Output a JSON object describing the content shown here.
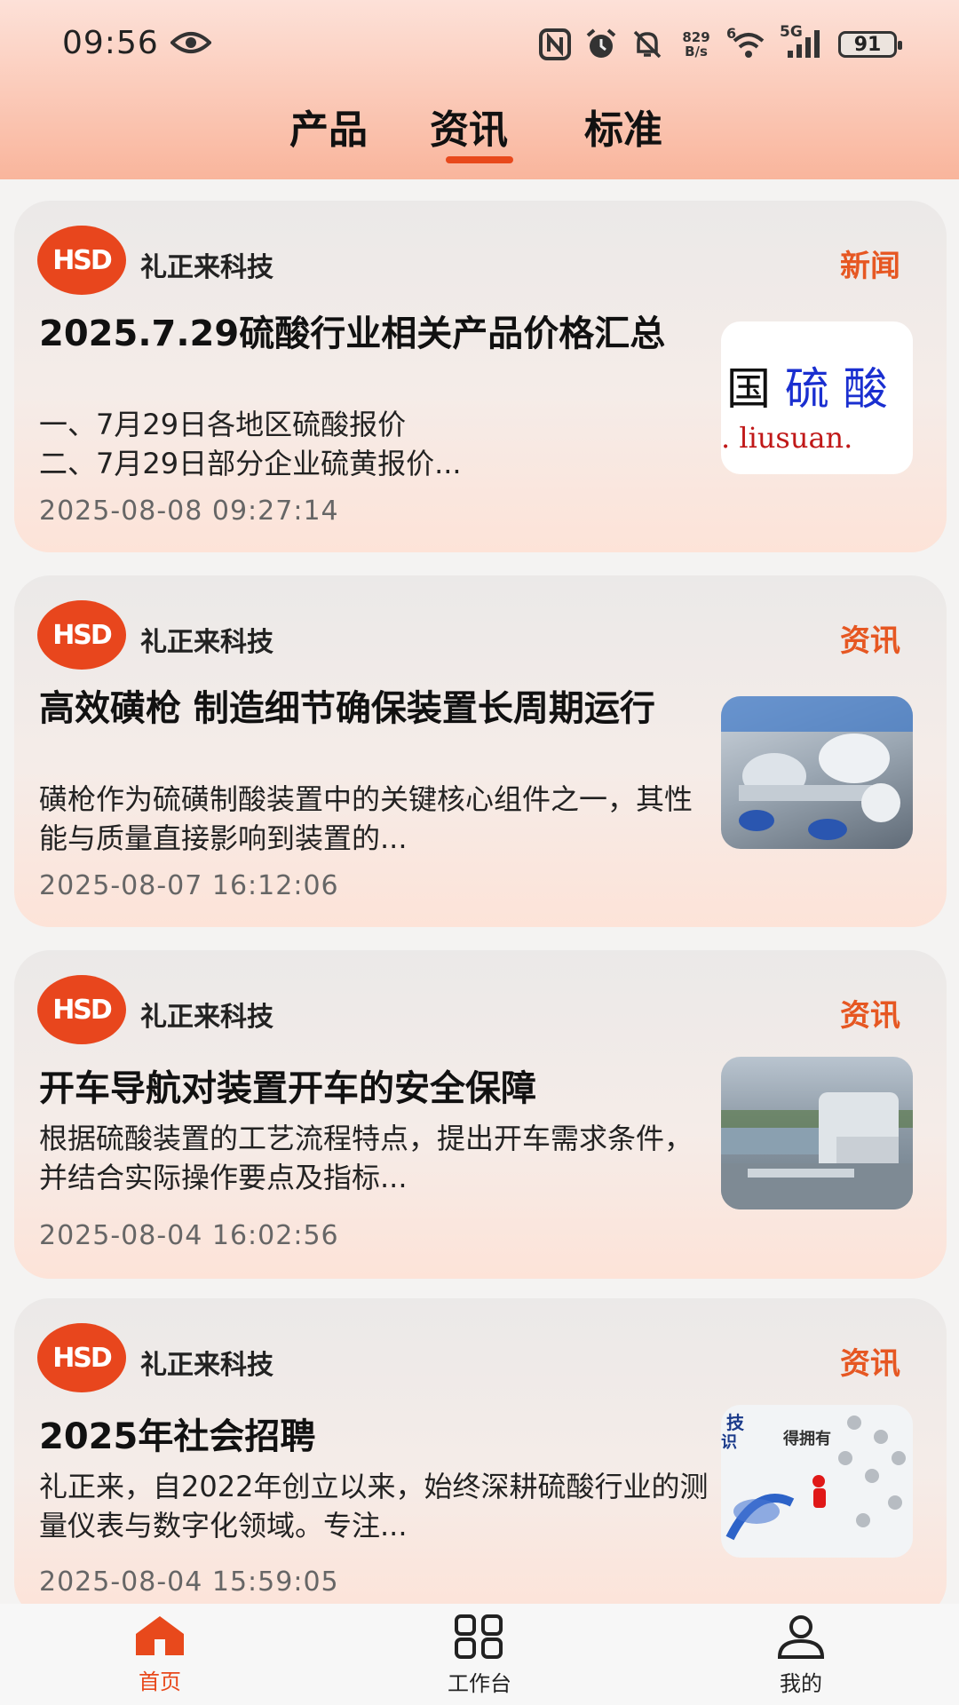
{
  "status_bar": {
    "time": "09:56",
    "net_speed_value": "829",
    "net_speed_unit": "B/s",
    "wifi_badge": "6",
    "signal_label": "5G",
    "battery": "91"
  },
  "tabs": [
    {
      "label": "产品",
      "active": false
    },
    {
      "label": "资讯",
      "active": true
    },
    {
      "label": "标准",
      "active": false
    }
  ],
  "thumb_text": {
    "line1a": "国",
    "line1b": "硫 酸",
    "line2": ". liusuan.",
    "card4a": "技",
    "card4b": "识",
    "card4c": "得拥有"
  },
  "cards": [
    {
      "logo": "HSD",
      "source": "礼正来科技",
      "tag": "新闻",
      "title": "2025.7.29硫酸行业相关产品价格汇总",
      "summary": "一、7月29日各地区硫酸报价\n二、7月29日部分企业硫黄报价...",
      "time": "2025-08-08 09:27:14"
    },
    {
      "logo": "HSD",
      "source": "礼正来科技",
      "tag": "资讯",
      "title": "高效磺枪 制造细节确保装置长周期运行",
      "summary": "磺枪作为硫磺制酸装置中的关键核心组件之一，其性能与质量直接影响到装置的...",
      "time": "2025-08-07 16:12:06"
    },
    {
      "logo": "HSD",
      "source": "礼正来科技",
      "tag": "资讯",
      "title": "开车导航对装置开车的安全保障",
      "summary": "根据硫酸装置的工艺流程特点，提出开车需求条件，并结合实际操作要点及指标...",
      "time": "2025-08-04 16:02:56"
    },
    {
      "logo": "HSD",
      "source": "礼正来科技",
      "tag": "资讯",
      "title": "2025年社会招聘",
      "summary": "礼正来，自2022年创立以来，始终深耕硫酸行业的测量仪表与数字化领域。专注...",
      "time": "2025-08-04 15:59:05"
    }
  ],
  "bottom_nav": [
    {
      "label": "首页",
      "icon": "home-icon",
      "active": true
    },
    {
      "label": "工作台",
      "icon": "grid-icon",
      "active": false
    },
    {
      "label": "我的",
      "icon": "person-icon",
      "active": false
    }
  ],
  "colors": {
    "accent": "#e8491c",
    "tag": "#e65722",
    "header_top": "#fde1d8",
    "header_bottom": "#f9b59c"
  }
}
